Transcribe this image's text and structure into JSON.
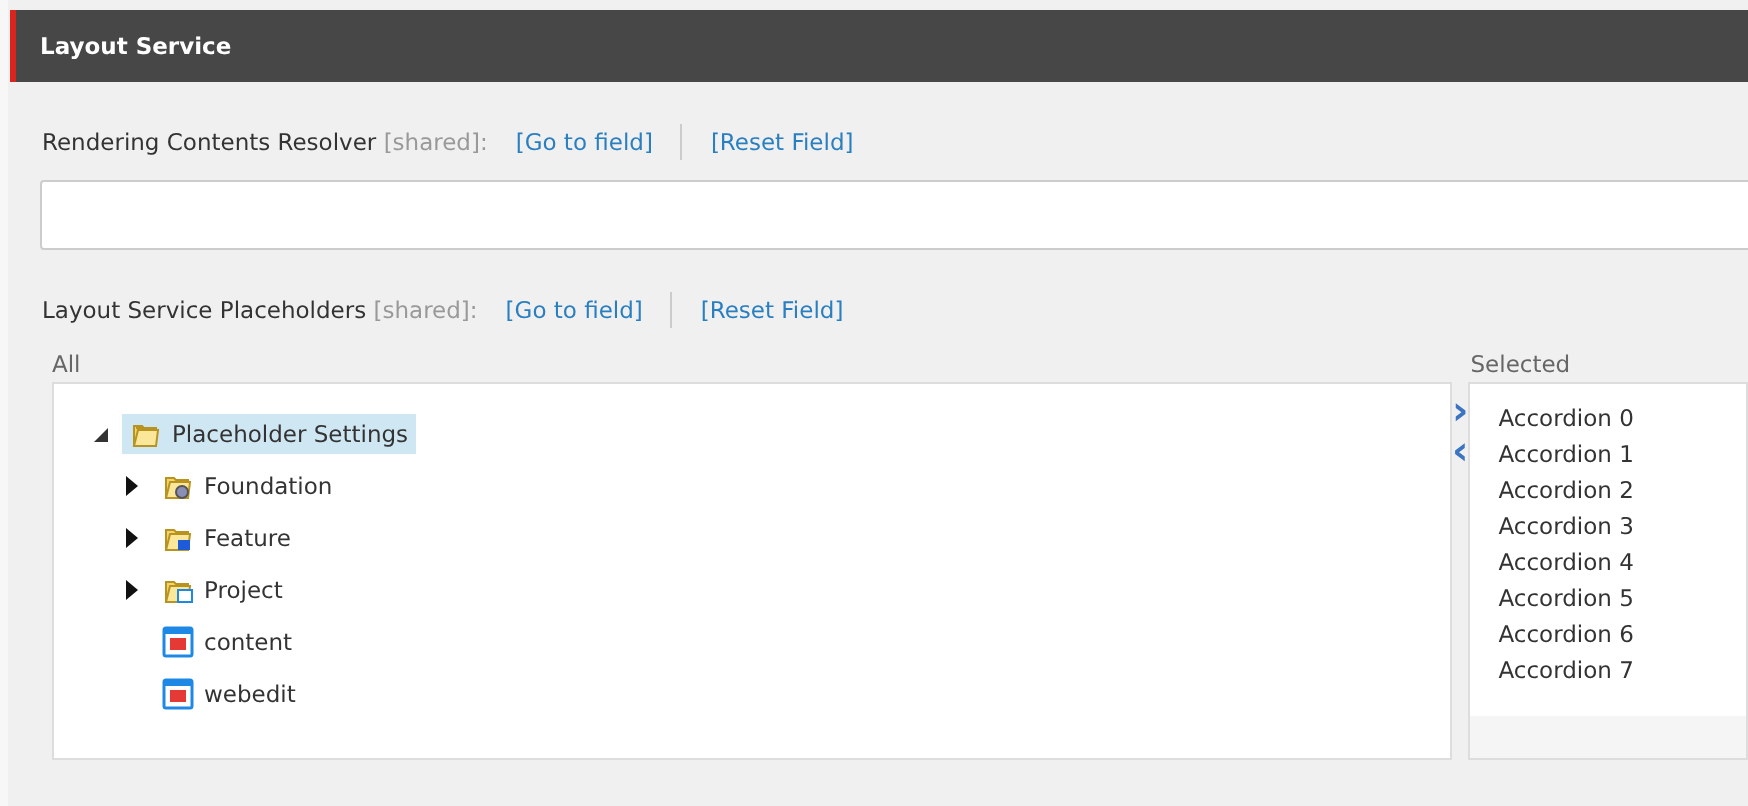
{
  "section": {
    "title": "Layout Service"
  },
  "fields": [
    {
      "label": "Rendering Contents Resolver",
      "shared": "[shared]:",
      "links": [
        "[Go to field]",
        "[Reset Field]"
      ],
      "kind": "input"
    },
    {
      "label": "Layout Service Placeholders",
      "shared": "[shared]:",
      "links": [
        "[Go to field]",
        "[Reset Field]"
      ],
      "kind": "treelist"
    }
  ],
  "all_label": "All",
  "tree": [
    {
      "label": "Placeholder Settings",
      "kind": "folder",
      "expanded": true,
      "selected": true,
      "children": [
        {
          "label": "Foundation",
          "kind": "gear-folder",
          "expanded": false,
          "selected": false
        },
        {
          "label": "Feature",
          "kind": "module-folder",
          "expanded": false,
          "selected": false
        },
        {
          "label": "Project",
          "kind": "window-folder",
          "expanded": false,
          "selected": false
        },
        {
          "label": "content",
          "kind": "placeholder",
          "selected": false
        },
        {
          "label": "webedit",
          "kind": "placeholder",
          "selected": false
        }
      ]
    }
  ],
  "move_buttons": [
    "›",
    "‹"
  ],
  "selected_label": "Selected",
  "selected_items": [
    "Accordion 0",
    "Accordion 1",
    "Accordion 2",
    "Accordion 3",
    "Accordion 4",
    "Accordion 5",
    "Accordion 6",
    "Accordion 7"
  ]
}
